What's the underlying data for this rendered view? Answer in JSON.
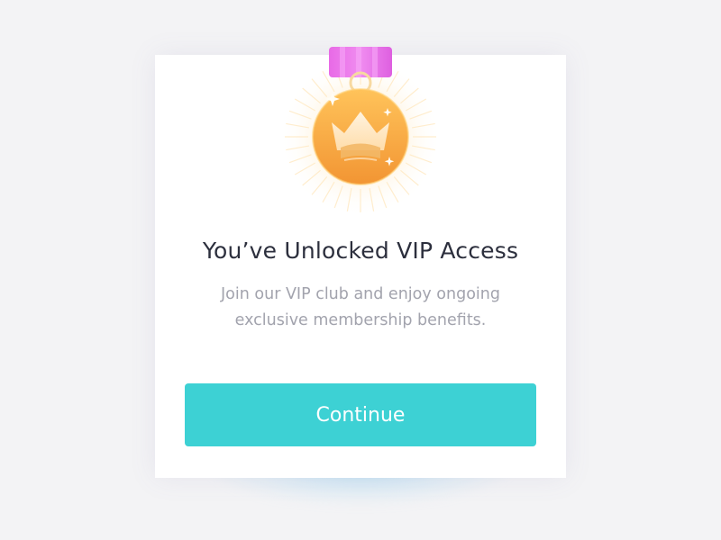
{
  "dialog": {
    "title": "You’ve Unlocked VIP Access",
    "message_line1": "Join our VIP club and enjoy ongoing",
    "message_line2": "exclusive membership benefits.",
    "continue_label": "Continue"
  },
  "badge": {
    "icon": "crown-medal-icon",
    "ribbon_color": "#e673e6",
    "medal_color": "#f5a63a"
  },
  "colors": {
    "accent": "#3dd1d4",
    "title": "#2c2f3d",
    "subtitle": "#a2a3ad"
  }
}
